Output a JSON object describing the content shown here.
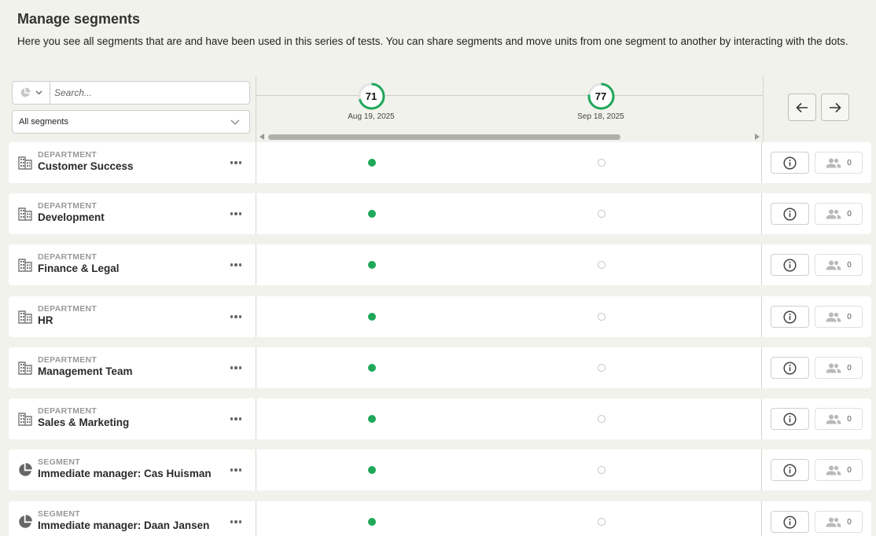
{
  "header": {
    "title": "Manage segments",
    "description": "Here you see all segments that are and have been used in this series of tests. You can share segments and move units from one segment to another by interacting with the dots."
  },
  "filters": {
    "search_placeholder": "Search...",
    "segment_select_value": "All segments",
    "type_select_icon": "pie-chart-icon"
  },
  "timeline": {
    "accent_color": "#1fa85a",
    "measurements": [
      {
        "score": "71",
        "date": "Aug 19, 2025",
        "progress": 0.71
      },
      {
        "score": "77",
        "date": "Sep 18, 2025",
        "progress": 0.77
      }
    ]
  },
  "navigation": {
    "prev_icon": "arrow-left-icon",
    "next_icon": "arrow-right-icon"
  },
  "rows": [
    {
      "type": "DEPARTMENT",
      "name": "Customer Success",
      "icon": "building-icon",
      "count": "0",
      "dots": [
        "filled",
        "empty"
      ]
    },
    {
      "type": "DEPARTMENT",
      "name": "Development",
      "icon": "building-icon",
      "count": "0",
      "dots": [
        "filled",
        "empty"
      ]
    },
    {
      "type": "DEPARTMENT",
      "name": "Finance & Legal",
      "icon": "building-icon",
      "count": "0",
      "dots": [
        "filled",
        "empty"
      ]
    },
    {
      "type": "DEPARTMENT",
      "name": "HR",
      "icon": "building-icon",
      "count": "0",
      "dots": [
        "filled",
        "empty"
      ]
    },
    {
      "type": "DEPARTMENT",
      "name": "Management Team",
      "icon": "building-icon",
      "count": "0",
      "dots": [
        "filled",
        "empty"
      ]
    },
    {
      "type": "DEPARTMENT",
      "name": "Sales & Marketing",
      "icon": "building-icon",
      "count": "0",
      "dots": [
        "filled",
        "empty"
      ]
    },
    {
      "type": "SEGMENT",
      "name": "Immediate manager: Cas Huisman",
      "icon": "pie-chart-icon",
      "count": "0",
      "dots": [
        "filled",
        "empty"
      ]
    },
    {
      "type": "SEGMENT",
      "name": "Immediate manager: Daan Jansen",
      "icon": "pie-chart-icon",
      "count": "0",
      "dots": [
        "filled",
        "empty"
      ]
    }
  ]
}
